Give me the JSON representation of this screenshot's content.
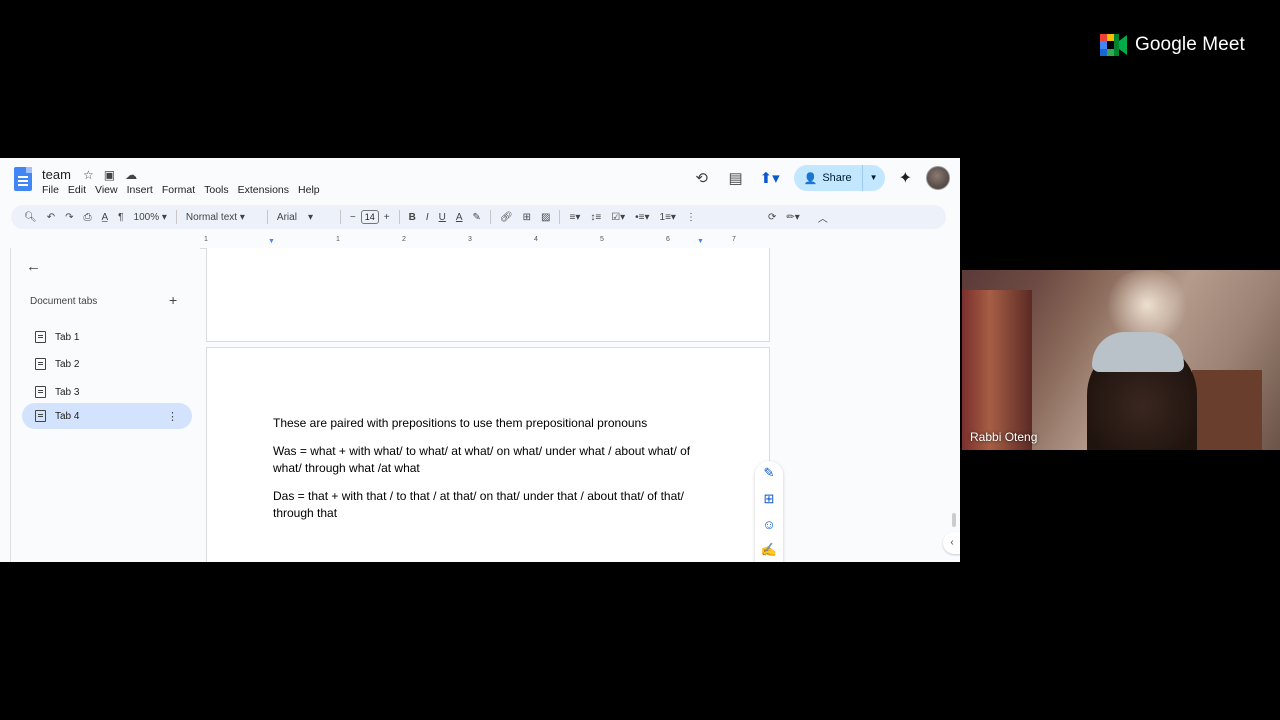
{
  "meet": {
    "brand": "Google Meet"
  },
  "docs": {
    "title": "team",
    "menu": [
      "File",
      "Edit",
      "View",
      "Insert",
      "Format",
      "Tools",
      "Extensions",
      "Help"
    ],
    "share_label": "Share",
    "toolbar": {
      "zoom": "100%",
      "style": "Normal text",
      "font": "Arial",
      "font_size": "14"
    },
    "ruler_numbers": [
      "1",
      "1",
      "2",
      "3",
      "4",
      "5",
      "6",
      "7"
    ],
    "sidebar": {
      "heading": "Document tabs",
      "tabs": [
        {
          "label": "Tab 1"
        },
        {
          "label": "Tab 2"
        },
        {
          "label": "Tab 3"
        },
        {
          "label": "Tab 4",
          "active": true
        }
      ]
    },
    "content": {
      "paragraphs": [
        "These are paired with prepositions to use them prepositional pronouns",
        "Was = what + with what/ to what/ at what/ on what/ under what / about what/ of  what/  through what /at what",
        "Das = that + with that / to that / at that/ on that/ under that / about that/ of that/ through that"
      ]
    }
  },
  "video": {
    "participant_name": "Rabbi Oteng"
  },
  "colors": {
    "accent": "#0b57d0",
    "share_bg": "#c2e7ff",
    "active_tab": "#d3e3fd"
  }
}
